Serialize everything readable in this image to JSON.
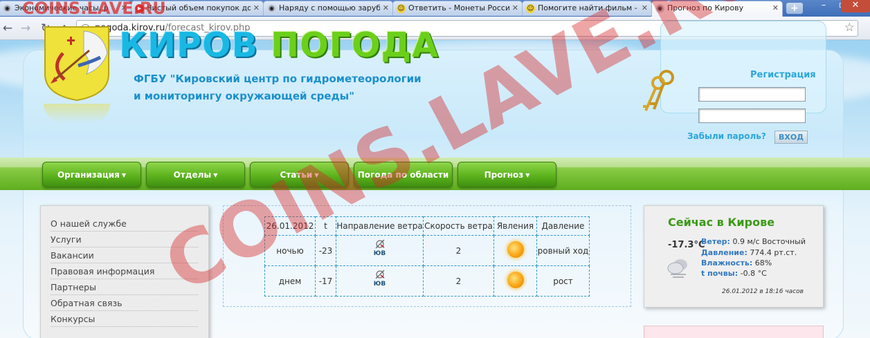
{
  "browser": {
    "tabs": [
      {
        "label": "Экономические часы, р"
      },
      {
        "label": "Чистый объем покупок дол"
      },
      {
        "label": "Наряду с помощью зарубе"
      },
      {
        "label": "Ответить - Монеты Россия"
      },
      {
        "label": "Помогите найти фильм - М"
      },
      {
        "label": "Прогноз по Кирову"
      }
    ],
    "url_host": "pogoda.kirov.ru",
    "url_path": "/forecast_kirov.php"
  },
  "watermark": {
    "top_text": "COINS.LAVE.RU",
    "big_text": "COINS.LAVE.RU"
  },
  "header": {
    "brand_word1": "КИРОВ",
    "brand_word2": "ПОГОДА",
    "org_line1": "ФГБУ \"Кировский центр по гидрометеорологии",
    "org_line2": "и мониторингу окружающей среды\""
  },
  "login": {
    "register_label": "Регистрация",
    "forgot_label": "Забыли пароль?",
    "enter_label": "ВХОД"
  },
  "menu": [
    {
      "label": "Организация",
      "caret": true
    },
    {
      "label": "Отделы",
      "caret": true
    },
    {
      "label": "Статьи",
      "caret": true
    },
    {
      "label": "Погода по области",
      "caret": false
    },
    {
      "label": "Прогноз",
      "caret": true
    }
  ],
  "sidebar": {
    "items": [
      {
        "label": "О нашей службе"
      },
      {
        "label": "Услуги"
      },
      {
        "label": "Вакансии"
      },
      {
        "label": "Правовая информация"
      },
      {
        "label": "Партнеры"
      },
      {
        "label": "Обратная связь"
      },
      {
        "label": "Конкурсы"
      }
    ]
  },
  "forecast": {
    "headers": [
      "26.01.2012",
      "t",
      "Направление ветра",
      "Скорость ветра",
      "Явления",
      "Давление"
    ],
    "rows": [
      {
        "period": "ночью",
        "temp": "-23",
        "wind_dir": "ЮВ",
        "wind_speed": "2",
        "phenomenon": "sun-icon",
        "pressure": "ровный ход"
      },
      {
        "period": "днем",
        "temp": "-17",
        "wind_dir": "ЮВ",
        "wind_speed": "2",
        "phenomenon": "sun-icon",
        "pressure": "рост"
      }
    ]
  },
  "now": {
    "title": "Сейчас в Кирове",
    "temp": "-17.3°C",
    "wind_label": "Ветер:",
    "wind_value": "0.9 м/с Восточный",
    "pressure_label": "Давление:",
    "pressure_value": "774.4 рт.ст.",
    "humidity_label": "Влажность:",
    "humidity_value": "68%",
    "soil_label": "t почвы:",
    "soil_value": "-0.8 °C",
    "stamp": "26.01.2012 в 18:16 часов"
  },
  "colors": {
    "brand_blue": "#19b8e4",
    "brand_green": "#6ccf1c",
    "menu_green": "#5cb31d",
    "link_blue": "#2ba6d9",
    "now_title_green": "#3b9a16"
  }
}
